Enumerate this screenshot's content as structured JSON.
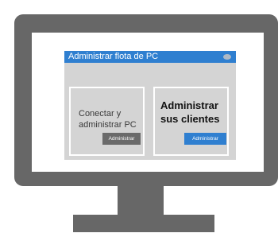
{
  "window": {
    "title": "Administrar flota de PC"
  },
  "cards": [
    {
      "label": "Conectar y administrar PC",
      "button": "Administrar"
    },
    {
      "label": "Administrar sus clientes",
      "button": "Administrar"
    }
  ],
  "colors": {
    "monitor": "#676767",
    "title_bar": "#2f7fd0",
    "window_bg": "#d4d4d4",
    "button_gray": "#6a6a6a",
    "button_blue": "#2f7fd0"
  }
}
